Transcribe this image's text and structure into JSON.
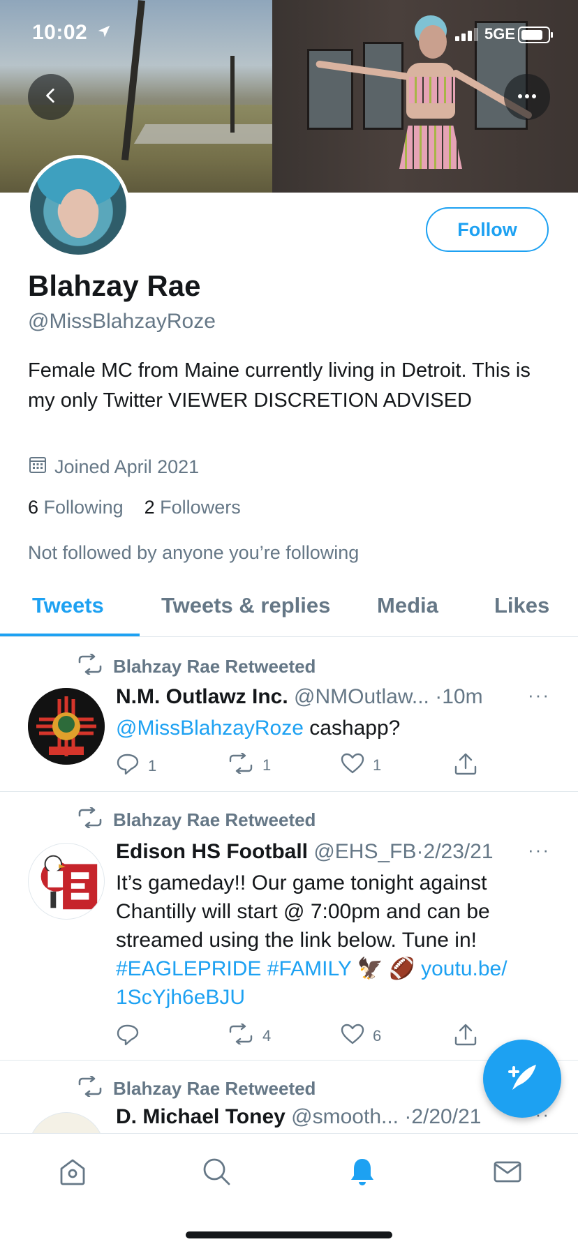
{
  "status_bar": {
    "time": "10:02",
    "network": "5GE"
  },
  "profile": {
    "name": "Blahzay Rae",
    "handle": "@MissBlahzayRoze",
    "follow_label": "Follow",
    "bio": "Female MC from Maine currently living in Detroit. This is my only Twitter VIEWER DISCRETION ADVISED",
    "joined": "Joined April 2021",
    "following_count": "6",
    "following_label": "Following",
    "followers_count": "2",
    "followers_label": "Followers",
    "not_followed": "Not followed by anyone you’re following"
  },
  "tabs": [
    {
      "label": "Tweets",
      "active": true
    },
    {
      "label": "Tweets & replies",
      "active": false
    },
    {
      "label": "Media",
      "active": false
    },
    {
      "label": "Likes",
      "active": false
    }
  ],
  "tweets": [
    {
      "retweet_label": "Blahzay Rae Retweeted",
      "name": "N.M. Outlawz Inc.",
      "handle": "@NMOutlaw...",
      "time": "·10m",
      "mention": "@MissBlahzayRoze",
      "text": " cashapp?",
      "replies": "1",
      "retweets": "1",
      "likes": "1"
    },
    {
      "retweet_label": "Blahzay Rae Retweeted",
      "name": "Edison HS Football",
      "handle": "@EHS_FB",
      "time": "·2/23/21",
      "text": "It’s gameday!! Our game tonight against Chantilly will start @ 7:00pm and can be streamed using the link below. Tune in!",
      "hashtags": "#EAGLEPRIDE #FAMILY",
      "emoji": "🦅 🏈",
      "link": "youtu.be/ 1ScYjh6eBJU",
      "replies": "",
      "retweets": "4",
      "likes": "6"
    },
    {
      "retweet_label": "Blahzay Rae Retweeted",
      "name": "D. Michael Toney",
      "handle": "@smooth...",
      "time": "·2/20/21"
    }
  ],
  "icons": {
    "back": "chevron-left-icon",
    "more": "more-icon",
    "calendar": "calendar-icon",
    "retweet": "retweet-icon",
    "reply": "reply-icon",
    "like": "heart-icon",
    "share": "share-icon",
    "compose": "compose-icon",
    "home": "home-icon",
    "search": "search-icon",
    "notifications": "bell-icon",
    "messages": "mail-icon"
  },
  "colors": {
    "accent": "#1da1f2",
    "secondary_text": "#657786",
    "primary_text": "#14171a"
  }
}
